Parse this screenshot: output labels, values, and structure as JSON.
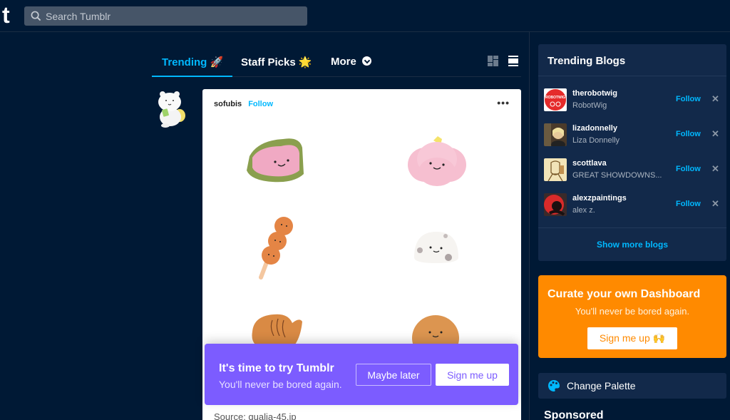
{
  "header": {
    "logo": "t",
    "search_placeholder": "Search Tumblr"
  },
  "tabs": [
    {
      "label": "Trending",
      "emoji": "🚀",
      "active": true
    },
    {
      "label": "Staff Picks",
      "emoji": "🌟",
      "active": false
    },
    {
      "label": "More",
      "active": false
    }
  ],
  "view_toggles": [
    "grid-view-icon",
    "list-view-icon"
  ],
  "post": {
    "username": "sofubis",
    "follow_label": "Follow",
    "menu_label": "•••",
    "source": "Source: qualia-45.jp"
  },
  "banner": {
    "title": "It's time to try Tumblr",
    "subtitle": "You'll never be bored again.",
    "maybe_later": "Maybe later",
    "sign_me_up": "Sign me up",
    "color": "#7c5cff"
  },
  "sidebar": {
    "trending_title": "Trending Blogs",
    "blogs": [
      {
        "name": "therobotwig",
        "title": "RobotWig",
        "follow": "Follow",
        "close": "✕"
      },
      {
        "name": "lizadonnelly",
        "title": "Liza Donnelly",
        "follow": "Follow",
        "close": "✕"
      },
      {
        "name": "scottlava",
        "title": "GREAT SHOWDOWNS...",
        "follow": "Follow",
        "close": "✕"
      },
      {
        "name": "alexzpaintings",
        "title": "alex z.",
        "follow": "Follow",
        "close": "✕"
      }
    ],
    "show_more": "Show more blogs",
    "curate": {
      "title": "Curate your own Dashboard",
      "subtitle": "You'll never be bored again.",
      "button": "Sign me up 🙌",
      "color": "#ff8a00"
    },
    "palette_label": "Change Palette",
    "sponsored": "Sponsored"
  },
  "colors": {
    "background": "#001935",
    "accent": "#00b8ff",
    "panel": "#12294a"
  }
}
